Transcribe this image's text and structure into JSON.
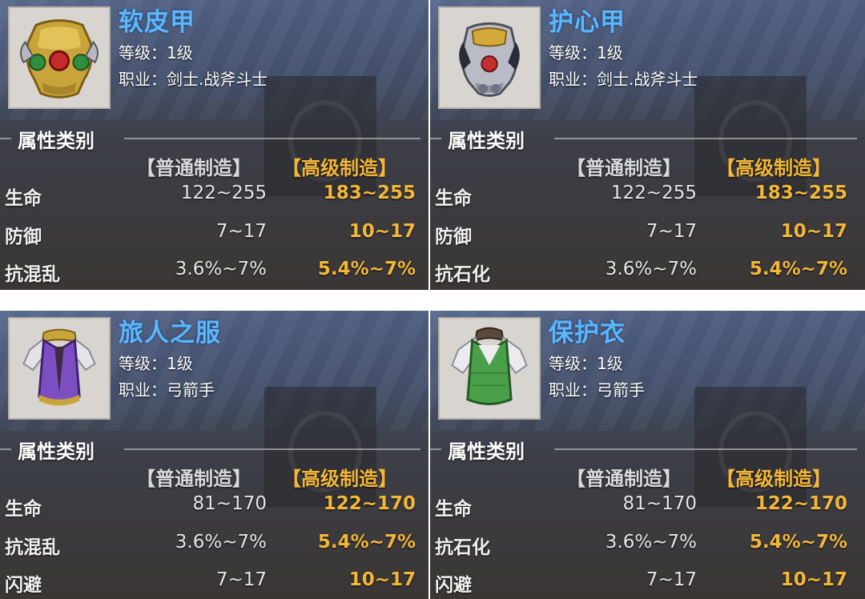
{
  "labels": {
    "level_prefix": "等级：",
    "class_prefix": "职业：",
    "section_title": "属性类别",
    "normal_craft": "【普通制造】",
    "advanced_craft": "【高级制造】"
  },
  "colors": {
    "item_name": "#5ab8ff",
    "advanced_value": "#f2b73a",
    "normal_value": "#e6e6e8"
  },
  "items": [
    {
      "name": "软皮甲",
      "level": "1级",
      "class": "剑士.战斧斗士",
      "icon": "gold-armor-icon",
      "stats": [
        {
          "label": "生命",
          "normal": "122~255",
          "advanced": "183~255"
        },
        {
          "label": "防御",
          "normal": "7~17",
          "advanced": "10~17"
        },
        {
          "label": "抗混乱",
          "normal": "3.6%~7%",
          "advanced": "5.4%~7%"
        }
      ]
    },
    {
      "name": "护心甲",
      "level": "1级",
      "class": "剑士.战斧斗士",
      "icon": "silver-armor-icon",
      "stats": [
        {
          "label": "生命",
          "normal": "122~255",
          "advanced": "183~255"
        },
        {
          "label": "防御",
          "normal": "7~17",
          "advanced": "10~17"
        },
        {
          "label": "抗石化",
          "normal": "3.6%~7%",
          "advanced": "5.4%~7%"
        }
      ]
    },
    {
      "name": "旅人之服",
      "level": "1级",
      "class": "弓箭手",
      "icon": "purple-vest-icon",
      "stats": [
        {
          "label": "生命",
          "normal": "81~170",
          "advanced": "122~170"
        },
        {
          "label": "抗混乱",
          "normal": "3.6%~7%",
          "advanced": "5.4%~7%"
        },
        {
          "label": "闪避",
          "normal": "7~17",
          "advanced": "10~17"
        }
      ]
    },
    {
      "name": "保护衣",
      "level": "1级",
      "class": "弓箭手",
      "icon": "green-vest-icon",
      "stats": [
        {
          "label": "生命",
          "normal": "81~170",
          "advanced": "122~170"
        },
        {
          "label": "抗石化",
          "normal": "3.6%~7%",
          "advanced": "5.4%~7%"
        },
        {
          "label": "闪避",
          "normal": "7~17",
          "advanced": "10~17"
        }
      ]
    }
  ]
}
